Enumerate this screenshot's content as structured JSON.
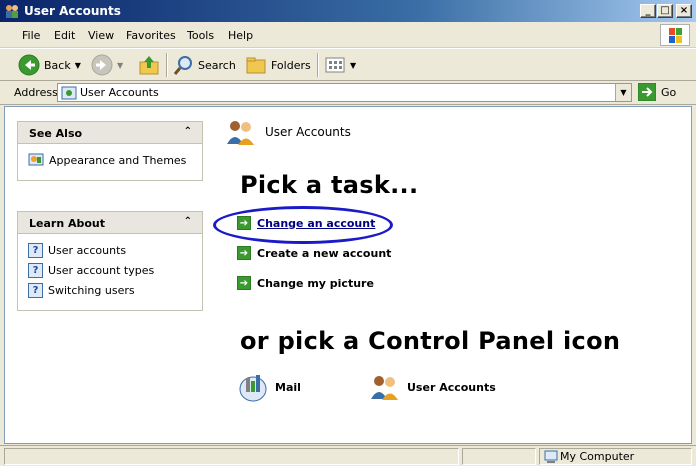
{
  "window": {
    "title": "User Accounts",
    "controls": [
      "minimize",
      "maximize",
      "close"
    ]
  },
  "menu": [
    "File",
    "Edit",
    "View",
    "Favorites",
    "Tools",
    "Help"
  ],
  "toolbar": {
    "back_label": "Back",
    "search_label": "Search",
    "folders_label": "Folders"
  },
  "address": {
    "label": "Address",
    "value": "User Accounts",
    "go_label": "Go"
  },
  "sidebar": {
    "see_also": {
      "title": "See Also",
      "items": [
        "Appearance and Themes"
      ]
    },
    "learn_about": {
      "title": "Learn About",
      "items": [
        "User accounts",
        "User account types",
        "Switching users"
      ]
    }
  },
  "content": {
    "header": "User Accounts",
    "pick_task": "Pick a task...",
    "tasks": [
      "Change an account",
      "Create a new account",
      "Change my picture"
    ],
    "or_pick": "or pick a Control Panel icon",
    "icons": [
      "Mail",
      "User Accounts"
    ]
  },
  "status": {
    "location": "My Computer"
  },
  "colors": {
    "titlebar": "#0a246a",
    "highlight": "#1a1ac8",
    "task_arrow": "#3a9a2f"
  }
}
